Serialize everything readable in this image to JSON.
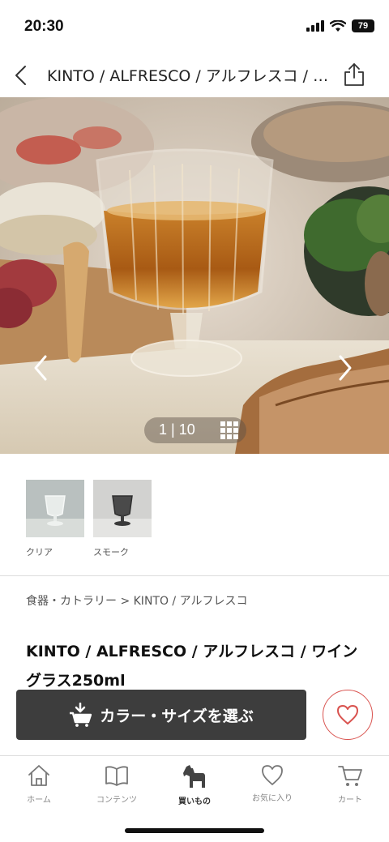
{
  "status_bar": {
    "time": "20:30",
    "battery": "79"
  },
  "nav": {
    "title": "KINTO / ALFRESCO / アルフレスコ / ワイングラス250ml"
  },
  "gallery": {
    "counter": "1 | 10",
    "current": 1,
    "total": 10
  },
  "colors": {
    "items": [
      {
        "label": "クリア",
        "icon": "clear-glass"
      },
      {
        "label": "スモーク",
        "icon": "smoke-glass"
      }
    ]
  },
  "breadcrumb": "食器・カトラリー > KINTO / アルフレスコ",
  "product": {
    "title": "KINTO / ALFRESCO / アルフレスコ / ワイングラス250ml"
  },
  "actions": {
    "select_label": "カラー・サイズを選ぶ",
    "accent": "#d9534f",
    "button_bg": "#3d3d3d"
  },
  "tabs": [
    {
      "label": "ホーム",
      "icon": "home-icon",
      "active": false
    },
    {
      "label": "コンテンツ",
      "icon": "book-icon",
      "active": false
    },
    {
      "label": "買いもの",
      "icon": "horse-icon",
      "active": true
    },
    {
      "label": "お気に入り",
      "icon": "heart-icon",
      "active": false
    },
    {
      "label": "カート",
      "icon": "cart-icon",
      "active": false
    }
  ]
}
